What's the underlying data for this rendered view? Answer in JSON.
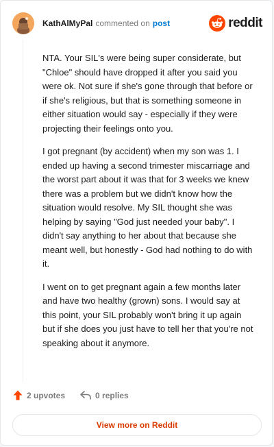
{
  "header": {
    "author": "KathAlMyPal",
    "action": "commented on",
    "post_link": "post",
    "brand": "reddit"
  },
  "comment": {
    "paragraphs": [
      "NTA. Your SIL's were being super considerate, but \"Chloe\" should have dropped it after you said you were ok. Not sure if she's gone through that before or if she's religious, but that is something someone in either situation would say - especially if they were projecting their feelings onto you.",
      "I got pregnant (by accident) when my son was 1. I ended up having a second trimester miscarriage and the worst part about it was that for 3 weeks we knew there was a problem but we didn't know how the situation would resolve. My SIL thought she was helping by saying \"God just needed your baby\". I didn't say anything to her about that because she meant well, but honestly - God had nothing to do with it.",
      "I went on to get pregnant again a few months later and have two healthy (grown) sons. I would say at this point, your SIL probably won't bring it up again but if she does you just have to tell her that you're not speaking about it anymore."
    ]
  },
  "footer": {
    "upvotes": "2 upvotes",
    "replies": "0 replies",
    "view_more": "View more on Reddit"
  },
  "icons": {
    "upvote": "upvote-arrow-icon",
    "reply": "reply-arrow-icon",
    "brand": "reddit-snoo-icon",
    "avatar": "user-avatar"
  },
  "colors": {
    "accent": "#ff4500",
    "link": "#0079d3",
    "view_more": "#d93a00",
    "muted": "#7c7c7c"
  }
}
